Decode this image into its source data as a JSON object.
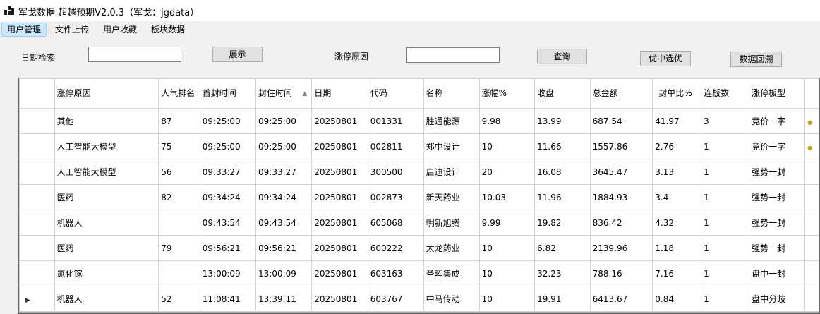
{
  "window": {
    "title": "军戈数据 超越预期V2.0.3（军戈：jgdata）"
  },
  "menu": [
    {
      "label": "用户管理",
      "active": true
    },
    {
      "label": "文件上传",
      "active": false
    },
    {
      "label": "用户收藏",
      "active": false
    },
    {
      "label": "板块数据",
      "active": false
    }
  ],
  "filters": {
    "date_label": "日期检索",
    "date_value": "",
    "show_button": "展示",
    "reason_label": "涨停原因",
    "reason_value": "",
    "query_button": "查询",
    "select_button": "优中选优",
    "backtrack_button": "数据回溯"
  },
  "table": {
    "columns": [
      "涨停原因",
      "人气排名",
      "首封时间",
      "封住时间",
      "日期",
      "代码",
      "名称",
      "涨幅%",
      "收盘",
      "总金额",
      "封单比%",
      "连板数",
      "涨停板型"
    ],
    "sorted_column": "封住时间",
    "rows": [
      {
        "current": false,
        "cells": [
          "其他",
          "87",
          "09:25:00",
          "09:25:00",
          "20250801",
          "001331",
          "胜通能源",
          "9.98",
          "13.99",
          "687.54",
          "41.97",
          "3",
          "竞价一字"
        ]
      },
      {
        "current": false,
        "cells": [
          "人工智能大模型",
          "75",
          "09:25:00",
          "09:25:00",
          "20250801",
          "002811",
          "郑中设计",
          "10",
          "11.66",
          "1557.86",
          "2.76",
          "1",
          "竞价一字"
        ]
      },
      {
        "current": false,
        "cells": [
          "人工智能大模型",
          "56",
          "09:33:27",
          "09:33:27",
          "20250801",
          "300500",
          "启迪设计",
          "20",
          "16.08",
          "3645.47",
          "3.13",
          "1",
          "强势一封"
        ]
      },
      {
        "current": false,
        "cells": [
          "医药",
          "82",
          "09:34:24",
          "09:34:24",
          "20250801",
          "002873",
          "新天药业",
          "10.03",
          "11.96",
          "1884.93",
          "3.4",
          "1",
          "强势一封"
        ]
      },
      {
        "current": false,
        "cells": [
          "机器人",
          "",
          "09:43:54",
          "09:43:54",
          "20250801",
          "605068",
          "明新旭腾",
          "9.99",
          "19.82",
          "836.42",
          "4.32",
          "1",
          "强势一封"
        ]
      },
      {
        "current": false,
        "cells": [
          "医药",
          "79",
          "09:56:21",
          "09:56:21",
          "20250801",
          "600222",
          "太龙药业",
          "10",
          "6.82",
          "2139.96",
          "1.18",
          "1",
          "强势一封"
        ]
      },
      {
        "current": false,
        "cells": [
          "氮化镓",
          "",
          "13:00:09",
          "13:00:09",
          "20250801",
          "603163",
          "圣晖集成",
          "10",
          "32.23",
          "788.16",
          "7.16",
          "1",
          "盘中一封"
        ]
      },
      {
        "current": true,
        "cells": [
          "机器人",
          "52",
          "11:08:41",
          "13:39:11",
          "20250801",
          "603767",
          "中马传动",
          "10",
          "19.91",
          "6413.67",
          "0.84",
          "1",
          "盘中分歧"
        ]
      }
    ]
  }
}
